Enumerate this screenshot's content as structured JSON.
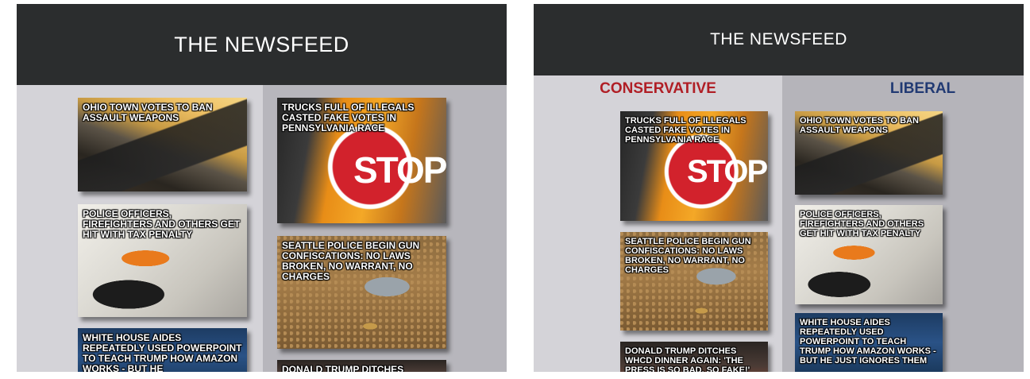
{
  "left_panel": {
    "title": "THE NEWSFEED",
    "cards": [
      {
        "headline": "OHIO TOWN VOTES TO BAN ASSAULT WEAPONS",
        "image": "assault-rifle"
      },
      {
        "headline": "POLICE OFFICERS, FIREFIGHTERS AND OTHERS GET HIT WITH TAX PENALTY",
        "image": "tax-form-calculator"
      },
      {
        "headline": "WHITE HOUSE AIDES REPEATEDLY USED POWERPOINT TO TEACH TRUMP HOW AMAZON WORKS - BUT HE",
        "image": "white-house"
      },
      {
        "headline": "TRUCKS FULL OF ILLEGALS CASTED FAKE VOTES IN PENNSYLVANIA RACE",
        "image": "school-bus-stop-sign"
      },
      {
        "headline": "SEATTLE POLICE BEGIN GUN CONFISCATIONS: NO LAWS BROKEN, NO WARRANT, NO CHARGES",
        "image": "revolver-bullets-sand"
      },
      {
        "headline": "DONALD TRUMP DITCHES",
        "image": "dinner"
      }
    ]
  },
  "right_panel": {
    "title": "THE NEWSFEED",
    "conservative_label": "CONSERVATIVE",
    "liberal_label": "LIBERAL",
    "conservative_cards": [
      {
        "headline": "TRUCKS FULL OF ILLEGALS CASTED FAKE VOTES IN PENNSYLVANIA RACE",
        "image": "school-bus-stop-sign"
      },
      {
        "headline": "SEATTLE POLICE BEGIN GUN CONFISCATIONS: NO LAWS BROKEN, NO WARRANT, NO CHARGES",
        "image": "revolver-bullets-sand"
      },
      {
        "headline": "DONALD TRUMP DITCHES WHCD DINNER AGAIN: 'THE PRESS IS SO BAD, SO FAKE!'",
        "image": "dinner"
      }
    ],
    "liberal_cards": [
      {
        "headline": "OHIO TOWN VOTES TO BAN ASSAULT WEAPONS",
        "image": "assault-rifle"
      },
      {
        "headline": "POLICE OFFICERS, FIREFIGHTERS AND OTHERS GET HIT WITH TAX PENALTY",
        "image": "tax-form-calculator"
      },
      {
        "headline": "WHITE HOUSE AIDES REPEATEDLY USED POWERPOINT TO TEACH TRUMP HOW AMAZON WORKS - BUT HE JUST IGNORES THEM",
        "image": "white-house"
      }
    ]
  },
  "stop_sign_text": "STOP",
  "colors": {
    "header_bg": "#2b2d2e",
    "conservative": "#b01e25",
    "liberal": "#213a73",
    "column_light": "#d4d3d8",
    "column_dark": "#b7b6bc"
  }
}
